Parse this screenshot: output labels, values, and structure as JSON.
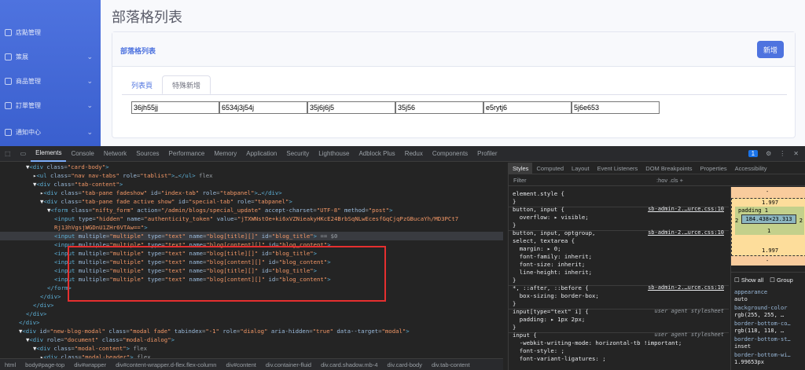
{
  "sidebar": {
    "items": [
      {
        "label": "店點管理",
        "expandable": false
      },
      {
        "label": "策展",
        "expandable": true
      },
      {
        "label": "商品管理",
        "expandable": true
      },
      {
        "label": "訂單管理",
        "expandable": true
      },
      {
        "label": "通知中心",
        "expandable": true
      }
    ]
  },
  "page": {
    "title": "部落格列表",
    "card_title": "部落格列表",
    "new_button": "新增",
    "tabs": [
      "列表頁",
      "特殊新增"
    ],
    "active_tab": 1,
    "inputs": [
      "36jh55jj",
      "6534j3j54j",
      "35j6j6j5",
      "35j56",
      "e5rytj6",
      "5j6e653"
    ]
  },
  "devtools": {
    "tabs": [
      "Elements",
      "Console",
      "Network",
      "Sources",
      "Performance",
      "Memory",
      "Application",
      "Security",
      "Lighthouse",
      "Adblock Plus",
      "Redux",
      "Components",
      "Profiler"
    ],
    "active_tab": "Elements",
    "issues_count": "1",
    "code": [
      {
        "indent": 3,
        "html": "<span class='tx'>▼</span><span class='tg'>&lt;div</span> <span class='at'>class</span>=<span class='av'>\"card-body\"</span><span class='tg'>&gt;</span>"
      },
      {
        "indent": 4,
        "html": "<span class='tx'>▸</span><span class='tg'>&lt;ul</span> <span class='at'>class</span>=<span class='av'>\"nav nav-tabs\"</span> <span class='at'>role</span>=<span class='av'>\"tablist\"</span><span class='tg'>&gt;</span>…<span class='tg'>&lt;/ul&gt;</span> flex"
      },
      {
        "indent": 4,
        "html": "<span class='tx'>▼</span><span class='tg'>&lt;div</span> <span class='at'>class</span>=<span class='av'>\"tab-content\"</span><span class='tg'>&gt;</span>"
      },
      {
        "indent": 5,
        "html": "<span class='tx'>▸</span><span class='tg'>&lt;div</span> <span class='at'>class</span>=<span class='av'>\"tab-pane fadeshow\"</span> <span class='at'>id</span>=<span class='av'>\"index-tab\"</span> <span class='at'>role</span>=<span class='av'>\"tabpanel\"</span><span class='tg'>&gt;</span>…<span class='tg'>&lt;/div&gt;</span>"
      },
      {
        "indent": 5,
        "html": "<span class='tx'>▼</span><span class='tg'>&lt;div</span> <span class='at'>class</span>=<span class='av'>\"tab-pane fade active show\"</span> <span class='at'>id</span>=<span class='av'>\"special-tab\"</span> <span class='at'>role</span>=<span class='av'>\"tabpanel\"</span><span class='tg'>&gt;</span>"
      },
      {
        "indent": 6,
        "html": "<span class='tx'>▼</span><span class='tg'>&lt;form</span> <span class='at'>class</span>=<span class='av'>\"nifty_form\"</span> <span class='at'>action</span>=<span class='av'>\"/admin/blogs/special_update\"</span> <span class='at'>accept-charset</span>=<span class='av'>\"UTF-8\"</span> <span class='at'>method</span>=<span class='av'>\"post\"</span><span class='tg'>&gt;</span>"
      },
      {
        "indent": 7,
        "html": "<span class='tg'>&lt;input</span> <span class='at'>type</span>=<span class='av'>\"hidden\"</span> <span class='at'>name</span>=<span class='av'>\"authenticity_token\"</span> <span class='at'>value</span>=<span class='av'>\"jTXWNstOe+ki6xVZNieakyHKcE24BrbSqNLwEcesfGqCjqPzGBucaYh/MD3PCt7</span>"
      },
      {
        "indent": 7,
        "html": "<span class='av'>Rj13hVgsjWGDnU1ZHr6VTAw==\"</span><span class='tg'>&gt;</span>"
      },
      {
        "indent": 7,
        "html": "<span class='tg'>&lt;input</span> <span class='at'>multiple</span>=<span class='av'>\"multiple\"</span> <span class='at'>type</span>=<span class='av'>\"text\"</span> <span class='at'>name</span>=<span class='av'>\"blog[title][]\"</span> <span class='at'>id</span>=<span class='av'>\"blog_title\"</span><span class='tg'>&gt;</span> == $0",
        "hl": true
      },
      {
        "indent": 7,
        "html": "<span class='tg'>&lt;input</span> <span class='at'>multiple</span>=<span class='av'>\"multiple\"</span> <span class='at'>type</span>=<span class='av'>\"text\"</span> <span class='at'>name</span>=<span class='av'>\"blog[content][]\"</span> <span class='at'>id</span>=<span class='av'>\"blog_content\"</span><span class='tg'>&gt;</span>"
      },
      {
        "indent": 7,
        "html": "<span class='tg'>&lt;input</span> <span class='at'>multiple</span>=<span class='av'>\"multiple\"</span> <span class='at'>type</span>=<span class='av'>\"text\"</span> <span class='at'>name</span>=<span class='av'>\"blog[title][]\"</span> <span class='at'>id</span>=<span class='av'>\"blog_title\"</span><span class='tg'>&gt;</span>"
      },
      {
        "indent": 7,
        "html": "<span class='tg'>&lt;input</span> <span class='at'>multiple</span>=<span class='av'>\"multiple\"</span> <span class='at'>type</span>=<span class='av'>\"text\"</span> <span class='at'>name</span>=<span class='av'>\"blog[content][]\"</span> <span class='at'>id</span>=<span class='av'>\"blog_content\"</span><span class='tg'>&gt;</span>"
      },
      {
        "indent": 7,
        "html": "<span class='tg'>&lt;input</span> <span class='at'>multiple</span>=<span class='av'>\"multiple\"</span> <span class='at'>type</span>=<span class='av'>\"text\"</span> <span class='at'>name</span>=<span class='av'>\"blog[title][]\"</span> <span class='at'>id</span>=<span class='av'>\"blog_title\"</span><span class='tg'>&gt;</span>"
      },
      {
        "indent": 7,
        "html": "<span class='tg'>&lt;input</span> <span class='at'>multiple</span>=<span class='av'>\"multiple\"</span> <span class='at'>type</span>=<span class='av'>\"text\"</span> <span class='at'>name</span>=<span class='av'>\"blog[content][]\"</span> <span class='at'>id</span>=<span class='av'>\"blog_content\"</span><span class='tg'>&gt;</span>"
      },
      {
        "indent": 6,
        "html": "<span class='tg'>&lt;/form&gt;</span>"
      },
      {
        "indent": 5,
        "html": "<span class='tg'>&lt;/div&gt;</span>"
      },
      {
        "indent": 4,
        "html": "<span class='tg'>&lt;/div&gt;</span>"
      },
      {
        "indent": 3,
        "html": "<span class='tg'>&lt;/div&gt;</span>"
      },
      {
        "indent": 2,
        "html": "<span class='tg'>&lt;/div&gt;</span>"
      },
      {
        "indent": 2,
        "html": "<span class='tx'>▼</span><span class='tg'>&lt;div</span> <span class='at'>id</span>=<span class='av'>\"new-blog-modal\"</span> <span class='at'>class</span>=<span class='av'>\"modal fade\"</span> <span class='at'>tabindex</span>=<span class='av'>\"-1\"</span> <span class='at'>role</span>=<span class='av'>\"dialog\"</span> <span class='at'>aria-hidden</span>=<span class='av'>\"true\"</span> <span class='at'>data--target</span>=<span class='av'>\"modal\"</span><span class='tg'>&gt;</span>"
      },
      {
        "indent": 3,
        "html": "<span class='tx'>▼</span><span class='tg'>&lt;div</span> <span class='at'>role</span>=<span class='av'>\"document\"</span> <span class='at'>class</span>=<span class='av'>\"modal-dialog\"</span><span class='tg'>&gt;</span>"
      },
      {
        "indent": 4,
        "html": "<span class='tx'>▼</span><span class='tg'>&lt;div</span> <span class='at'>class</span>=<span class='av'>\"modal-content\"</span><span class='tg'>&gt;</span> flex"
      },
      {
        "indent": 5,
        "html": "<span class='tx'>▸</span><span class='tg'>&lt;div</span> <span class='at'>class</span>=<span class='av'>\"modal-header\"</span><span class='tg'>&gt;</span> flex"
      }
    ],
    "breadcrumbs": [
      "html",
      "body#page-top",
      "div#wrapper",
      "div#content-wrapper.d-flex.flex-column",
      "div#content",
      "div.container-fluid",
      "div.card.shadow.mb-4",
      "div.card-body",
      "div.tab-content"
    ],
    "right_tabs": [
      "Styles",
      "Computed",
      "Layout",
      "Event Listeners",
      "DOM Breakpoints",
      "Properties",
      "Accessibility"
    ],
    "filter_placeholder": "Filter",
    "filter_tools": ":hov .cls +",
    "styles": [
      {
        "text": "element.style {",
        "src": ""
      },
      {
        "text": "}",
        "src": ""
      },
      {
        "text": "button, input {",
        "src": "sb-admin-2.…urce.css:10"
      },
      {
        "text": "  overflow: ▸ visible;",
        "src": ""
      },
      {
        "text": "}",
        "src": ""
      },
      {
        "text": "button, input, optgroup,",
        "src": "sb-admin-2.…urce.css:10"
      },
      {
        "text": "select, textarea {",
        "src": ""
      },
      {
        "text": "  margin: ▸ 0;",
        "src": ""
      },
      {
        "text": "  font-family: inherit;",
        "src": ""
      },
      {
        "text": "  font-size: inherit;",
        "src": ""
      },
      {
        "text": "  line-height: inherit;",
        "src": ""
      },
      {
        "text": "}",
        "src": ""
      },
      {
        "text": "*, ::after, ::before {",
        "src": "sb-admin-2.…urce.css:10"
      },
      {
        "text": "  box-sizing: border-box;",
        "src": ""
      },
      {
        "text": "}",
        "src": ""
      },
      {
        "text": "input[type=\"text\" i] {",
        "src": "user agent stylesheet",
        "ua": true
      },
      {
        "text": "  padding: ▸ 1px 2px;",
        "src": ""
      },
      {
        "text": "}",
        "src": ""
      },
      {
        "text": "input {",
        "src": "user agent stylesheet",
        "ua": true
      },
      {
        "text": "  -webkit-writing-mode: horizontal-tb !important;",
        "src": ""
      },
      {
        "text": "  font-style: ;",
        "src": ""
      },
      {
        "text": "  font-variant-ligatures: ;",
        "src": ""
      }
    ],
    "box_model": {
      "margin": "-",
      "border": "1.997",
      "padding": "padding 1",
      "content": "184.438×23.313",
      "side_left": "2",
      "side_right": "2",
      "pad_bottom": "1",
      "border_bottom": "1.997",
      "margin_bottom": "-",
      "label_left": "er"
    },
    "computed": {
      "show_all": "Show all",
      "group": "Group",
      "props": [
        {
          "name": "appearance",
          "value": "auto"
        },
        {
          "name": "background-color",
          "value": "rgb(255, 255, …"
        },
        {
          "name": "border-bottom-co…",
          "value": "rgb(118, 118, …"
        },
        {
          "name": "border-bottom-st…",
          "value": "inset"
        },
        {
          "name": "border-bottom-wi…",
          "value": "1.99653px"
        }
      ]
    }
  }
}
